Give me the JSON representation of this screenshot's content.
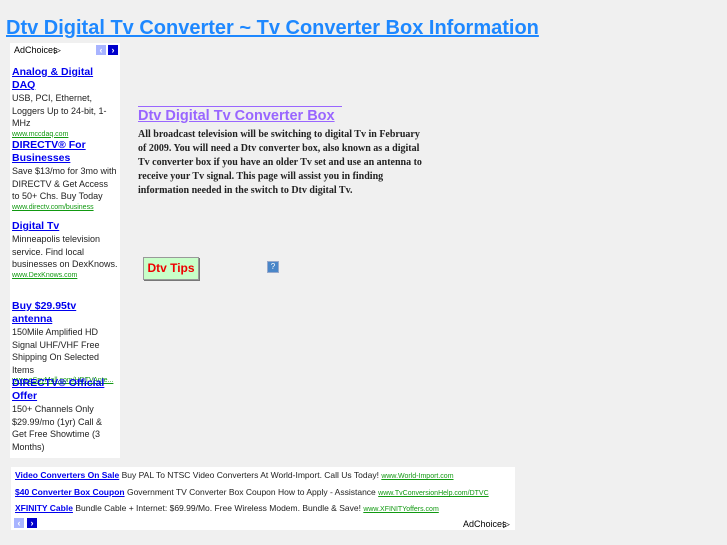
{
  "page_title": "Dtv Digital Tv Converter ~ Tv Converter Box Information",
  "side_ads": {
    "adchoices": "AdChoices",
    "items": [
      {
        "title": "Analog & Digital DAQ",
        "desc": "USB, PCI, Ethernet, Loggers Up to 24-bit, 1-MHz",
        "url": "www.mccdaq.com"
      },
      {
        "title": "DIRECTV® For Businesses",
        "desc": "Save $13/mo for 3mo with DIRECTV & Get Access to 50+ Chs. Buy Today",
        "url": "www.directv.com/business"
      },
      {
        "title": "Digital Tv",
        "desc": "Minneapolis television service. Find local businesses on DexKnows.",
        "url": "www.DexKnows.com"
      },
      {
        "title": "Buy $29.95tv antenna",
        "desc": "150Mile Amplified HD Signal UHF/VHF Free Shipping On Selected Items",
        "url": "www.eSpyMall.com/HDTVAnte..."
      },
      {
        "title": "DIRECTV® Official Offer",
        "desc": "150+ Channels Only $29.99/mo (1yr) Call & Get Free Showtime (3 Months)",
        "url": ""
      }
    ]
  },
  "main": {
    "heading": "Dtv Digital Tv Converter  Box",
    "paragraph": "All broadcast television will be switching to digital Tv in February of 2009. You will need a Dtv converter box, also known as a digital Tv converter box if you have an older Tv set and use an antenna to receive your Tv signal. This page will assist you in finding information needed in the switch to Dtv digital Tv.",
    "tips_button": "Dtv Tips",
    "help_icon": "?"
  },
  "bottom_ads": {
    "adchoices": "AdChoices",
    "items": [
      {
        "title": "Video Converters On Sale",
        "desc": "Buy PAL To NTSC Video Converters At World-Import. Call Us Today!",
        "url": "www.World-Import.com"
      },
      {
        "title": "$40 Converter Box Coupon",
        "desc": "Government TV Converter Box Coupon How to Apply - Assistance",
        "url": "www.TvConversionHelp.com/DTVC"
      },
      {
        "title": "XFINITY Cable",
        "desc": "Bundle Cable + Internet: $69.99/Mo. Free Wireless Modem. Bundle & Save!",
        "url": "www.XFINITYoffers.com"
      }
    ]
  },
  "colors": {
    "title": "#1e88ff",
    "heading": "#9966ff",
    "ad_link": "#0000ee",
    "ad_url": "#119911",
    "tips_bg": "#c8ffc8",
    "tips_text": "#ee0000"
  }
}
